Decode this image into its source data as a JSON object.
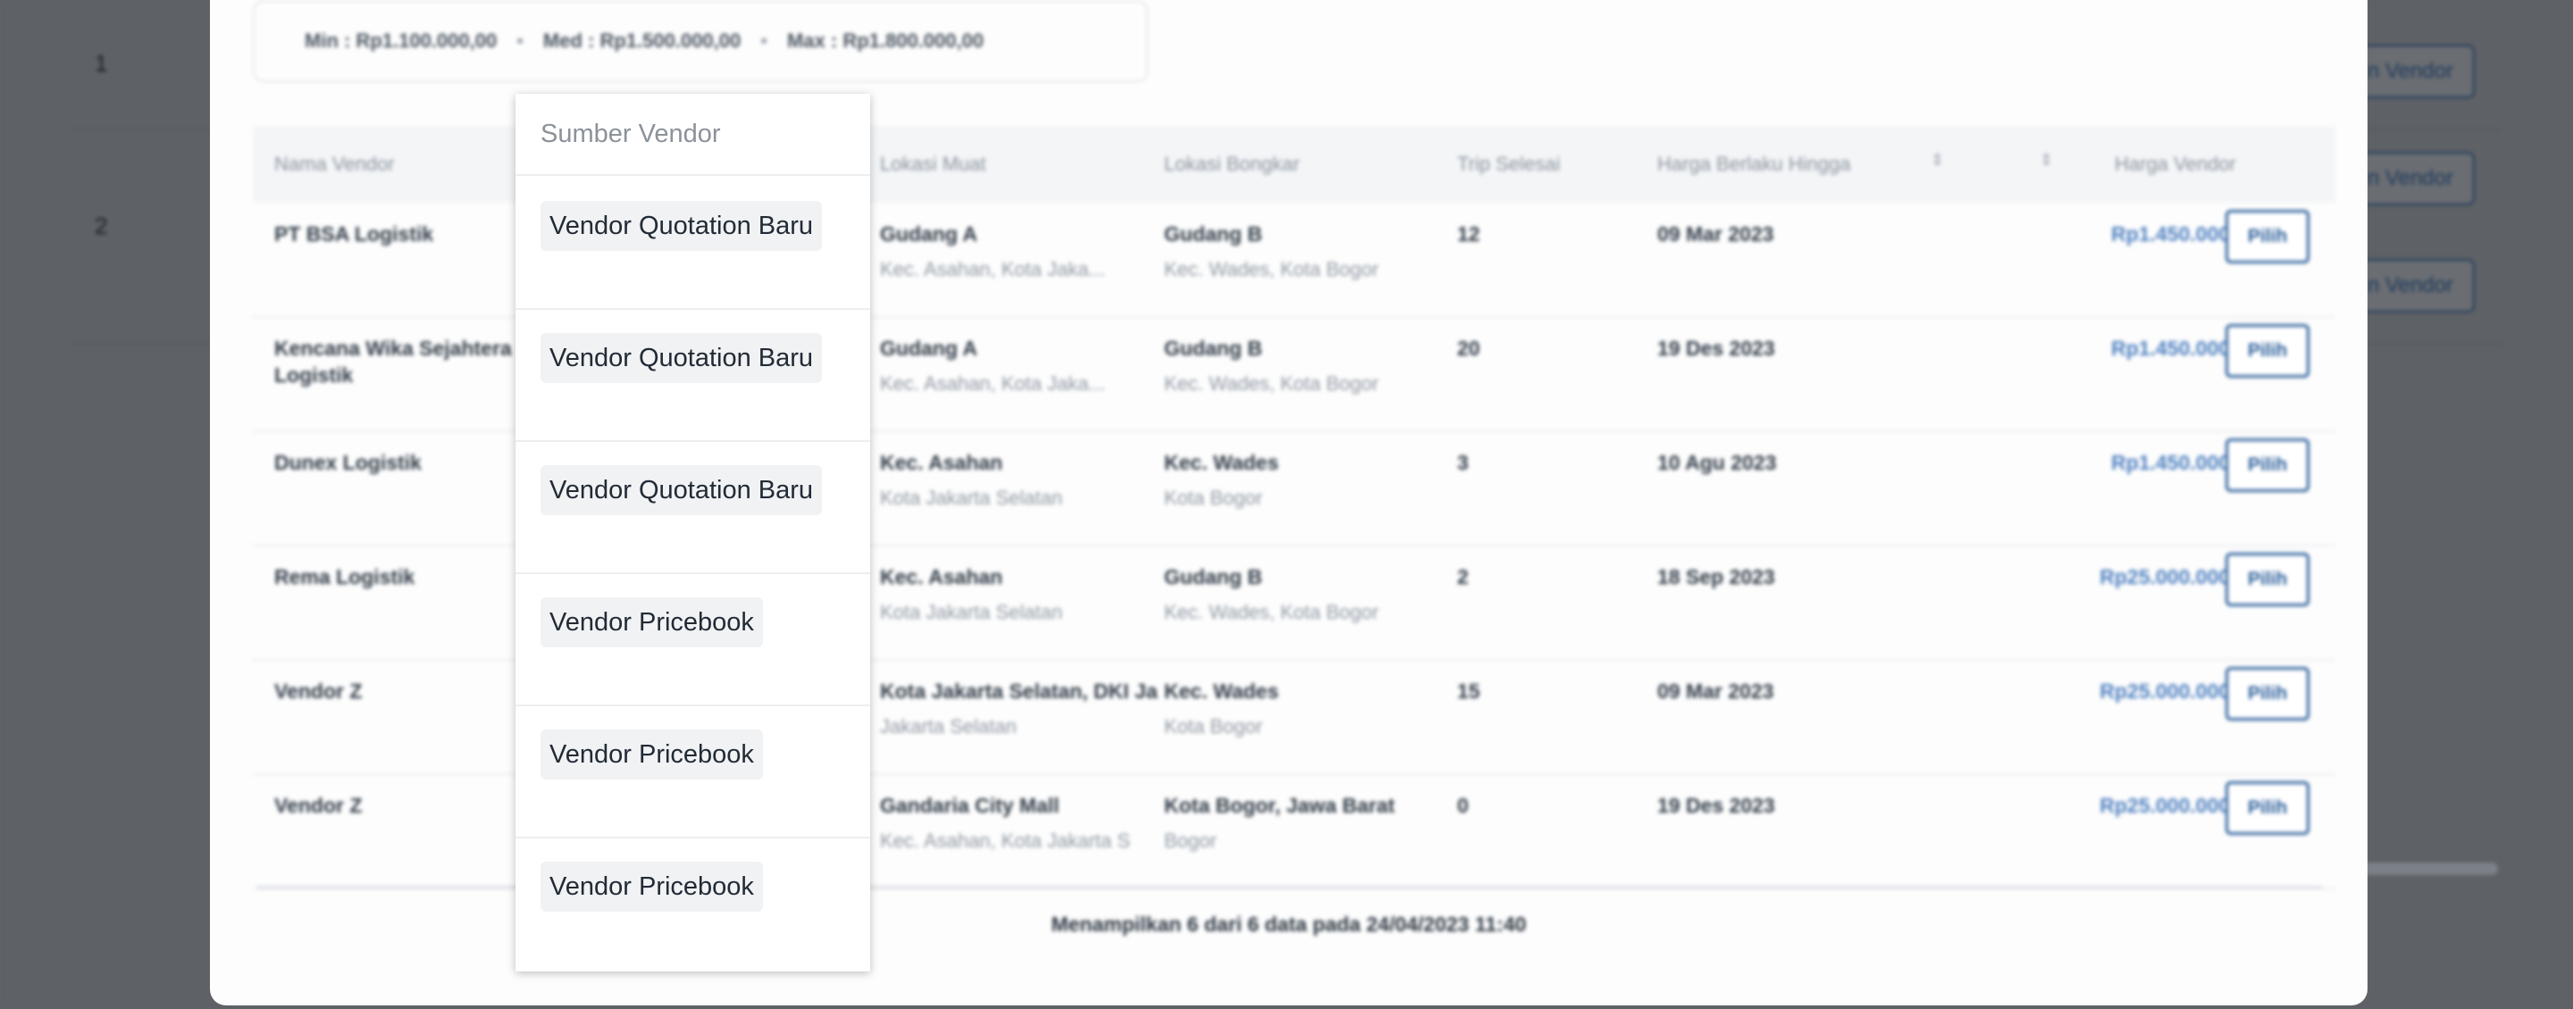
{
  "background": {
    "row_numbers": [
      "1",
      "2"
    ],
    "vendor_button_label": "n Vendor"
  },
  "modal": {
    "price_summary": {
      "min": "Min : Rp1.100.000,00",
      "med": "Med : Rp1.500.000,00",
      "max": "Max : Rp1.800.000,00",
      "separator": "•"
    },
    "table": {
      "headers": {
        "nama_vendor": "Nama Vendor",
        "lokasi_muat": "Lokasi Muat",
        "lokasi_bongkar": "Lokasi Bongkar",
        "trip_selesai": "Trip Selesai",
        "harga_berlaku": "Harga Berlaku Hingga",
        "harga_vendor": "Harga Vendor"
      },
      "rows": [
        {
          "vendor": "PT BSA Logistik",
          "vendor2": "",
          "muat": "Gudang A",
          "muat_sub": "Kec. Asahan, Kota Jaka...",
          "bongkar": "Gudang B",
          "bongkar_sub": "Kec. Wades, Kota Bogor",
          "trip": "12",
          "hingga": "09 Mar 2023",
          "harga": "Rp1.450.000,00",
          "action": "Pilih"
        },
        {
          "vendor": "Kencana Wika Sejahtera",
          "vendor2": "Logistik",
          "muat": "Gudang A",
          "muat_sub": "Kec. Asahan, Kota Jaka...",
          "bongkar": "Gudang B",
          "bongkar_sub": "Kec. Wades, Kota Bogor",
          "trip": "20",
          "hingga": "19 Des 2023",
          "harga": "Rp1.450.000,00",
          "action": "Pilih"
        },
        {
          "vendor": "Dunex Logistik",
          "vendor2": "",
          "muat": "Kec. Asahan",
          "muat_sub": "Kota Jakarta Selatan",
          "bongkar": "Kec. Wades",
          "bongkar_sub": "Kota Bogor",
          "trip": "3",
          "hingga": "10 Agu 2023",
          "harga": "Rp1.450.000,00",
          "action": "Pilih"
        },
        {
          "vendor": "Rema Logistik",
          "vendor2": "",
          "muat": "Kec. Asahan",
          "muat_sub": "Kota Jakarta Selatan",
          "bongkar": "Gudang B",
          "bongkar_sub": "Kec. Wades, Kota Bogor",
          "trip": "2",
          "hingga": "18 Sep 2023",
          "harga": "Rp25.000.000,99",
          "action": "Pilih"
        },
        {
          "vendor": "Vendor Z",
          "vendor2": "",
          "muat": "Kota Jakarta Selatan, DKI Ja",
          "muat_sub": "Jakarta Selatan",
          "bongkar": "Kec. Wades",
          "bongkar_sub": "Kota Bogor",
          "trip": "15",
          "hingga": "09 Mar 2023",
          "harga": "Rp25.000.000,99",
          "action": "Pilih"
        },
        {
          "vendor": "Vendor Z",
          "vendor2": "",
          "muat": "Gandaria City Mall",
          "muat_sub": "Kec. Asahan, Kota Jakarta S",
          "bongkar": "Kota Bogor, Jawa Barat",
          "bongkar_sub": "Bogor",
          "trip": "0",
          "hingga": "19 Des 2023",
          "harga": "Rp25.000.000,99",
          "action": "Pilih"
        }
      ],
      "footer": "Menampilkan 6 dari 6 data pada 24/04/2023 11:40"
    }
  },
  "dropdown": {
    "header": "Sumber Vendor",
    "items": [
      "Vendor Quotation Baru",
      "Vendor Quotation Baru",
      "Vendor Quotation Baru",
      "Vendor Pricebook",
      "Vendor Pricebook",
      "Vendor Pricebook"
    ]
  }
}
